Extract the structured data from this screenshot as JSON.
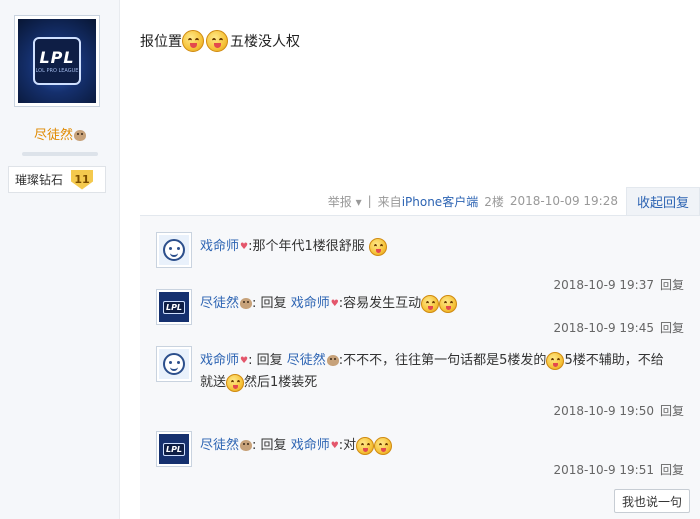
{
  "author": {
    "username": "尽徒然",
    "avatar_logo": "LPL",
    "avatar_sub": "LOL PRO LEAGUE",
    "badge_title": "璀璨钻石",
    "badge_level": "11"
  },
  "post": {
    "text_before": "报位置",
    "text_after": "五楼没人权",
    "meta": {
      "report": "举报",
      "separator": "|",
      "source_prefix": "来自",
      "source": "iPhone客户端",
      "floor": "2楼",
      "datetime": "2018-10-09 19:28",
      "collapse_label": "收起回复"
    }
  },
  "replies": [
    {
      "author": "戏命师",
      "avatar": "face",
      "segments": [
        {
          "type": "text",
          "value": ":那个年代1楼很舒服"
        }
      ],
      "time": "2018-10-9 19:37",
      "reply_label": "回复"
    },
    {
      "author": "尽徒然",
      "avatar": "lpl",
      "reply_label_prefix": "回复",
      "reply_to": "戏命师",
      "content": ":容易发生互动",
      "time": "2018-10-9 19:45",
      "reply_label": "回复"
    },
    {
      "author": "戏命师",
      "avatar": "face",
      "reply_label_prefix": "回复",
      "reply_to": "尽徒然",
      "content_part1": ":不不不，往往第一句话都是5楼发的",
      "content_part2": "5楼不辅助，不给",
      "content_part3": "就送",
      "content_part4": "然后1楼装死",
      "time": "2018-10-9 19:50",
      "reply_label": "回复"
    },
    {
      "author": "尽徒然",
      "avatar": "lpl",
      "reply_label_prefix": "回复",
      "reply_to": "戏命师",
      "content": ":对",
      "time": "2018-10-9 19:51",
      "reply_label": "回复"
    }
  ],
  "say_button": "我也说一句",
  "icons": {
    "heart": "♥",
    "report_arrow": "▾"
  },
  "colors": {
    "link": "#2d64b3",
    "username": "#e08a00",
    "badge": "#f4c94e"
  }
}
